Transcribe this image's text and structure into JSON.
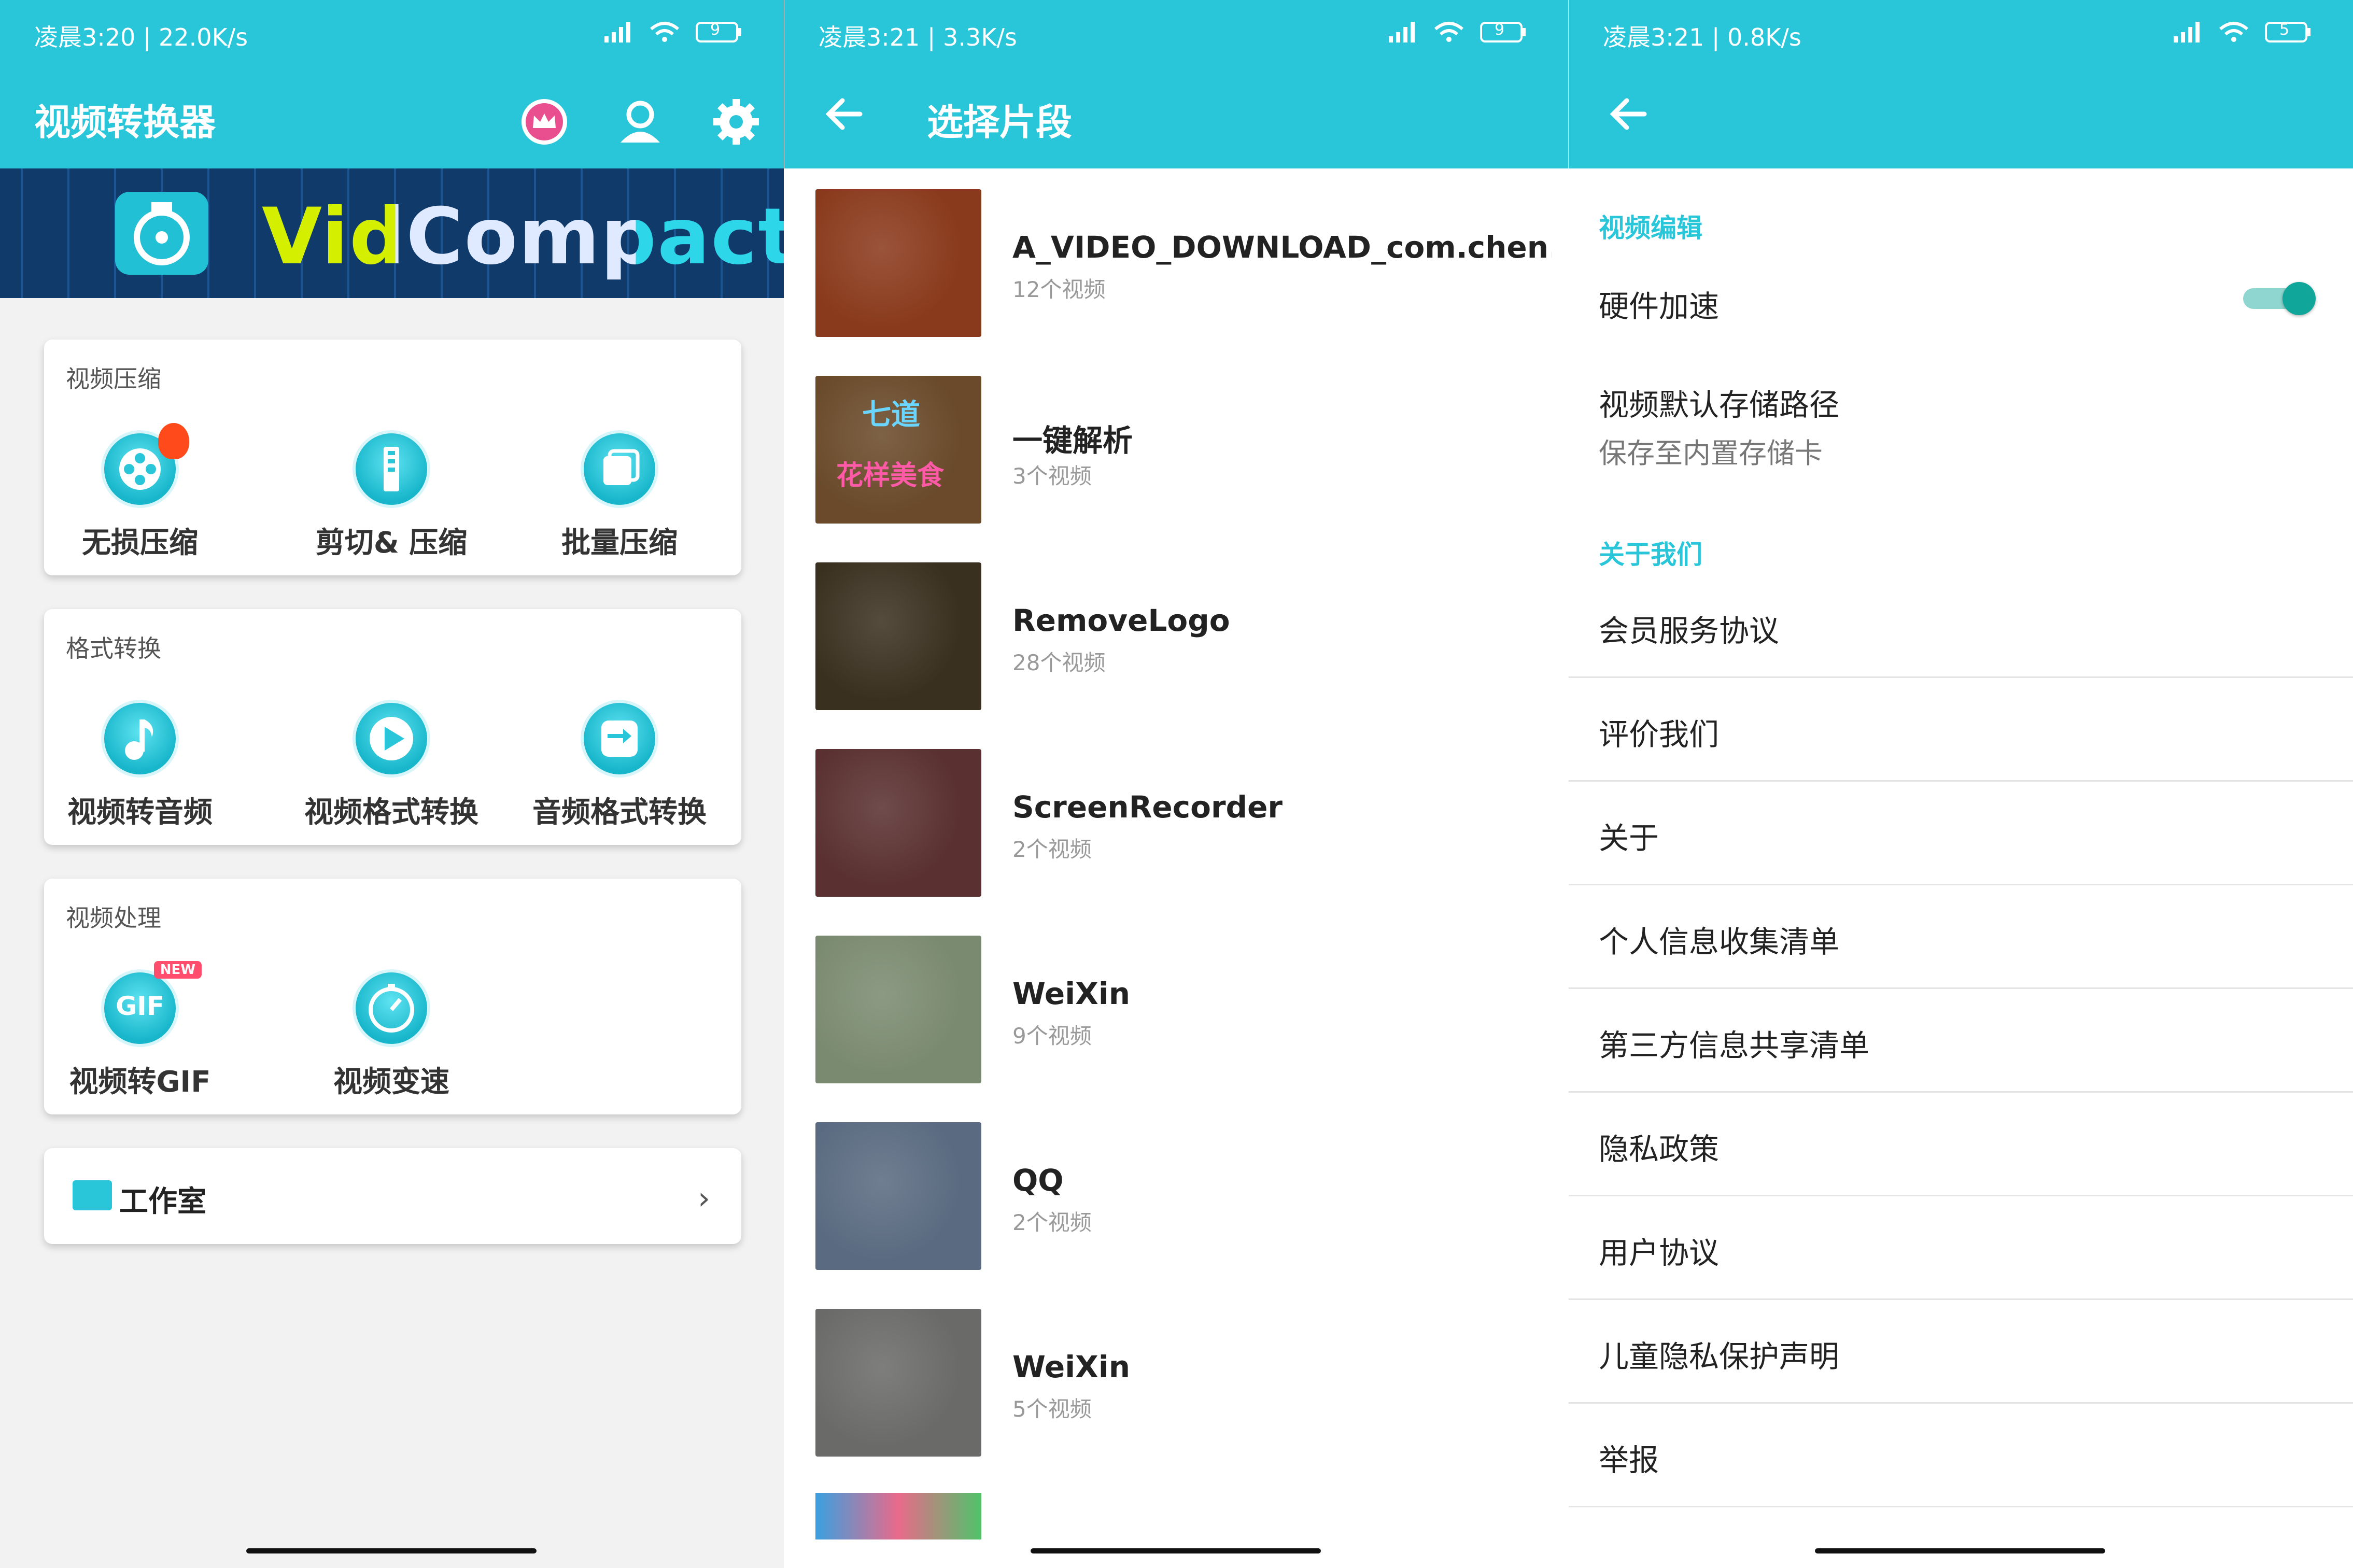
{
  "colors": {
    "accent": "#29c6da",
    "toggle_on": "#11a69a"
  },
  "panel1": {
    "status": "凌晨3:20 | 22.0K/s",
    "battery": "9",
    "title": "视频转换器",
    "banner_text": "VidCompact",
    "compress": {
      "title": "视频压缩",
      "tools": [
        {
          "label": "无损压缩",
          "icon": "film-reel-icon"
        },
        {
          "label": "剪切& 压缩",
          "icon": "zip-icon"
        },
        {
          "label": "批量压缩",
          "icon": "stack-icon"
        }
      ]
    },
    "convert": {
      "title": "格式转换",
      "tools": [
        {
          "label": "视频转音频",
          "icon": "music-note-icon"
        },
        {
          "label": "视频格式转换",
          "icon": "play-icon"
        },
        {
          "label": "音频格式转换",
          "icon": "swap-icon"
        }
      ]
    },
    "process": {
      "title": "视频处理",
      "tools": [
        {
          "label": "视频转GIF",
          "icon": "gif-icon",
          "badge": "NEW"
        },
        {
          "label": "视频变速",
          "icon": "speedometer-icon"
        }
      ]
    },
    "studio": "工作室"
  },
  "panel2": {
    "status": "凌晨3:21 | 3.3K/s",
    "battery": "9",
    "title": "选择片段",
    "folders": [
      {
        "name": "A_VIDEO_DOWNLOAD_com.chen.dou...",
        "count": "12个视频",
        "thumb": "#8a3a1c"
      },
      {
        "name": "一键解析",
        "count": "3个视频",
        "thumb": "#6a4a2a",
        "overlay1": "七道",
        "overlay2": "花样美食"
      },
      {
        "name": "RemoveLogo",
        "count": "28个视频",
        "thumb": "#3a3020"
      },
      {
        "name": "ScreenRecorder",
        "count": "2个视频",
        "thumb": "#5a3030"
      },
      {
        "name": "WeiXin",
        "count": "9个视频",
        "thumb": "#7a8a70"
      },
      {
        "name": "QQ",
        "count": "2个视频",
        "thumb": "#5a6a80"
      },
      {
        "name": "WeiXin",
        "count": "5个视频",
        "thumb": "#6a6a68"
      }
    ]
  },
  "panel3": {
    "status": "凌晨3:21 | 0.8K/s",
    "battery": "5",
    "section_edit": "视频编辑",
    "hw_accel": "硬件加速",
    "hw_accel_on": true,
    "storage_path": "视频默认存储路径",
    "storage_sub": "保存至内置存储卡",
    "section_about": "关于我们",
    "items": [
      "会员服务协议",
      "评价我们",
      "关于",
      "个人信息收集清单",
      "第三方信息共享清单",
      "隐私政策",
      "用户协议",
      "儿童隐私保护声明",
      "举报"
    ]
  }
}
